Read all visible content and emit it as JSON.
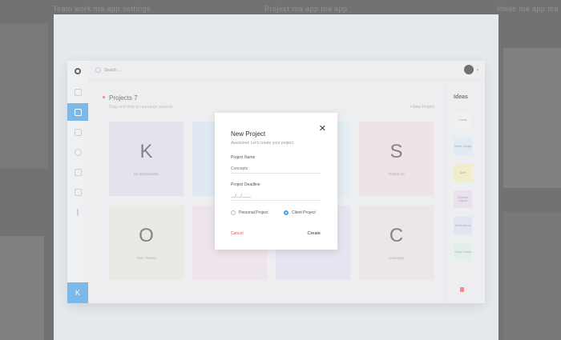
{
  "background": {
    "texts": [
      "Team work ma app settings",
      "Project ma app ma app",
      "Ideas ma app ma app"
    ]
  },
  "app": {
    "search": {
      "placeholder": "Search ...",
      "value": ""
    },
    "sidebar": {
      "items": [
        {
          "icon": "dashboard-icon",
          "active": false
        },
        {
          "icon": "hand-icon",
          "active": true
        },
        {
          "icon": "bell-icon",
          "active": false
        },
        {
          "icon": "chat-icon",
          "active": false
        },
        {
          "icon": "edit-icon",
          "active": false
        },
        {
          "icon": "mail-icon",
          "active": false
        },
        {
          "icon": "info-icon",
          "active": false
        }
      ],
      "avatar_letter": "K"
    },
    "projects": {
      "title": "Projects 7",
      "subtitle": "Drag and drop to rearrange projects",
      "new_project": "+ New Project",
      "cards": [
        {
          "letter": "K",
          "name": "Kit Dashboards",
          "color": "#dcd7e6"
        },
        {
          "letter": "",
          "name": "",
          "color": "#d4e1ef"
        },
        {
          "letter": "",
          "name": "",
          "color": "#d8e6ee"
        },
        {
          "letter": "S",
          "name": "Sketch Kit",
          "color": "#e6dcdb"
        },
        {
          "letter": "O",
          "name": "Own Theme",
          "color": "#e1e2d8"
        },
        {
          "letter": "",
          "name": "SMB UI Kit",
          "color": "#e6dbe3"
        },
        {
          "letter": "",
          "name": "Inspire UI",
          "color": "#dadcea"
        },
        {
          "letter": "C",
          "name": "Concepts",
          "color": "#e7dde0"
        }
      ]
    },
    "ideas": {
      "title": "Ideas",
      "items": [
        {
          "text": "Create",
          "color": "#e9ebee"
        },
        {
          "text": "Refine Design",
          "color": "#d5e4ef"
        },
        {
          "text": "Draft",
          "color": "#ece7b4"
        },
        {
          "text": "Refresh Layout",
          "color": "#e3d5e6"
        },
        {
          "text": "In Kit Library",
          "color": "#d7dbec"
        },
        {
          "text": "Check Colors",
          "color": "#d8e9e4"
        }
      ]
    }
  },
  "modal": {
    "title": "New Project",
    "subtitle": "Awesome! Let's create your project",
    "name_label": "Project Name",
    "name_placeholder": "Concepts",
    "deadline_label": "Project Deadline",
    "deadline_placeholder": "__/__/____",
    "option_personal": "Personal Project",
    "option_client": "Client Project",
    "selected": "client",
    "cancel": "Cancel",
    "create": "Create",
    "close_symbol": "✕"
  }
}
